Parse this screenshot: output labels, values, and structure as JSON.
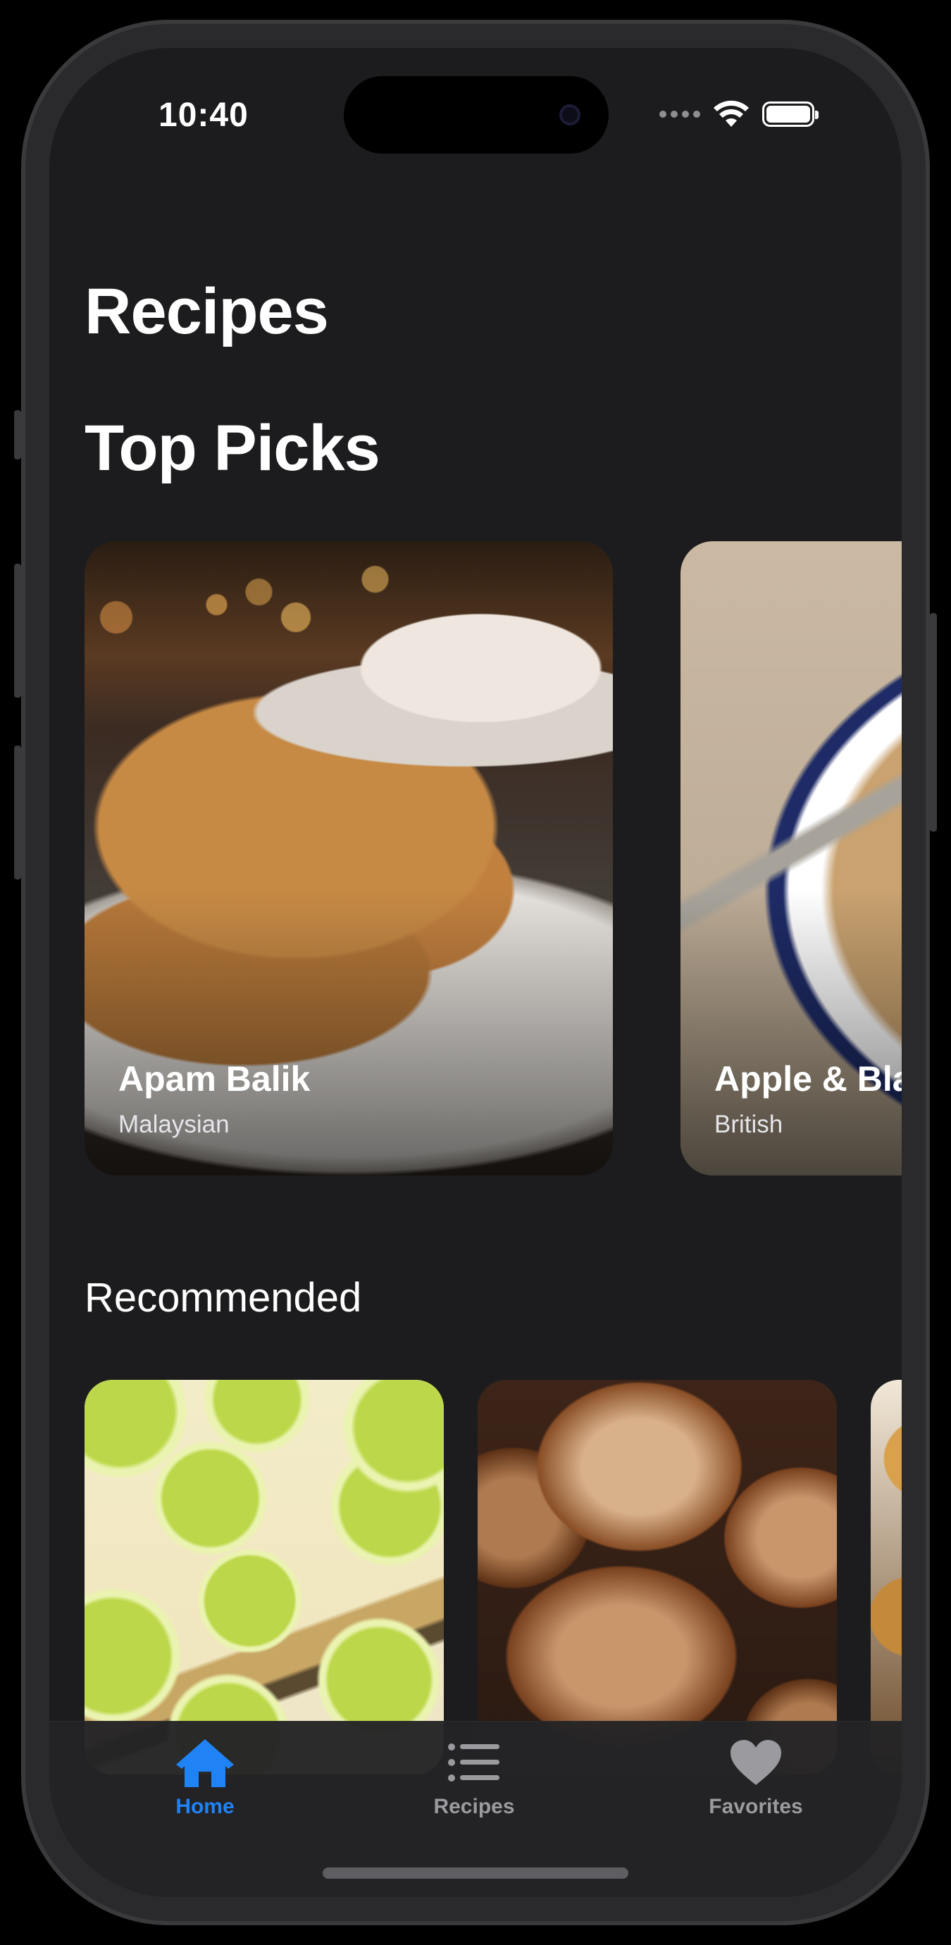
{
  "status_bar": {
    "time": "10:40",
    "icons": [
      "cellular-icon",
      "wifi-icon",
      "battery-icon"
    ]
  },
  "header": {
    "title": "Recipes"
  },
  "top_picks": {
    "title": "Top Picks",
    "cards": [
      {
        "name": "Apam Balik",
        "cuisine": "Malaysian"
      },
      {
        "name": "Apple & Blackberry Crumble",
        "cuisine": "British"
      }
    ]
  },
  "recommended": {
    "title": "Recommended"
  },
  "tab_bar": {
    "active": "Home",
    "accent_color": "#1f83f6",
    "inactive_color": "#9a9a9f",
    "tabs": [
      {
        "label": "Home",
        "icon": "house-icon"
      },
      {
        "label": "Recipes",
        "icon": "list-icon"
      },
      {
        "label": "Favorites",
        "icon": "heart-icon"
      }
    ]
  }
}
